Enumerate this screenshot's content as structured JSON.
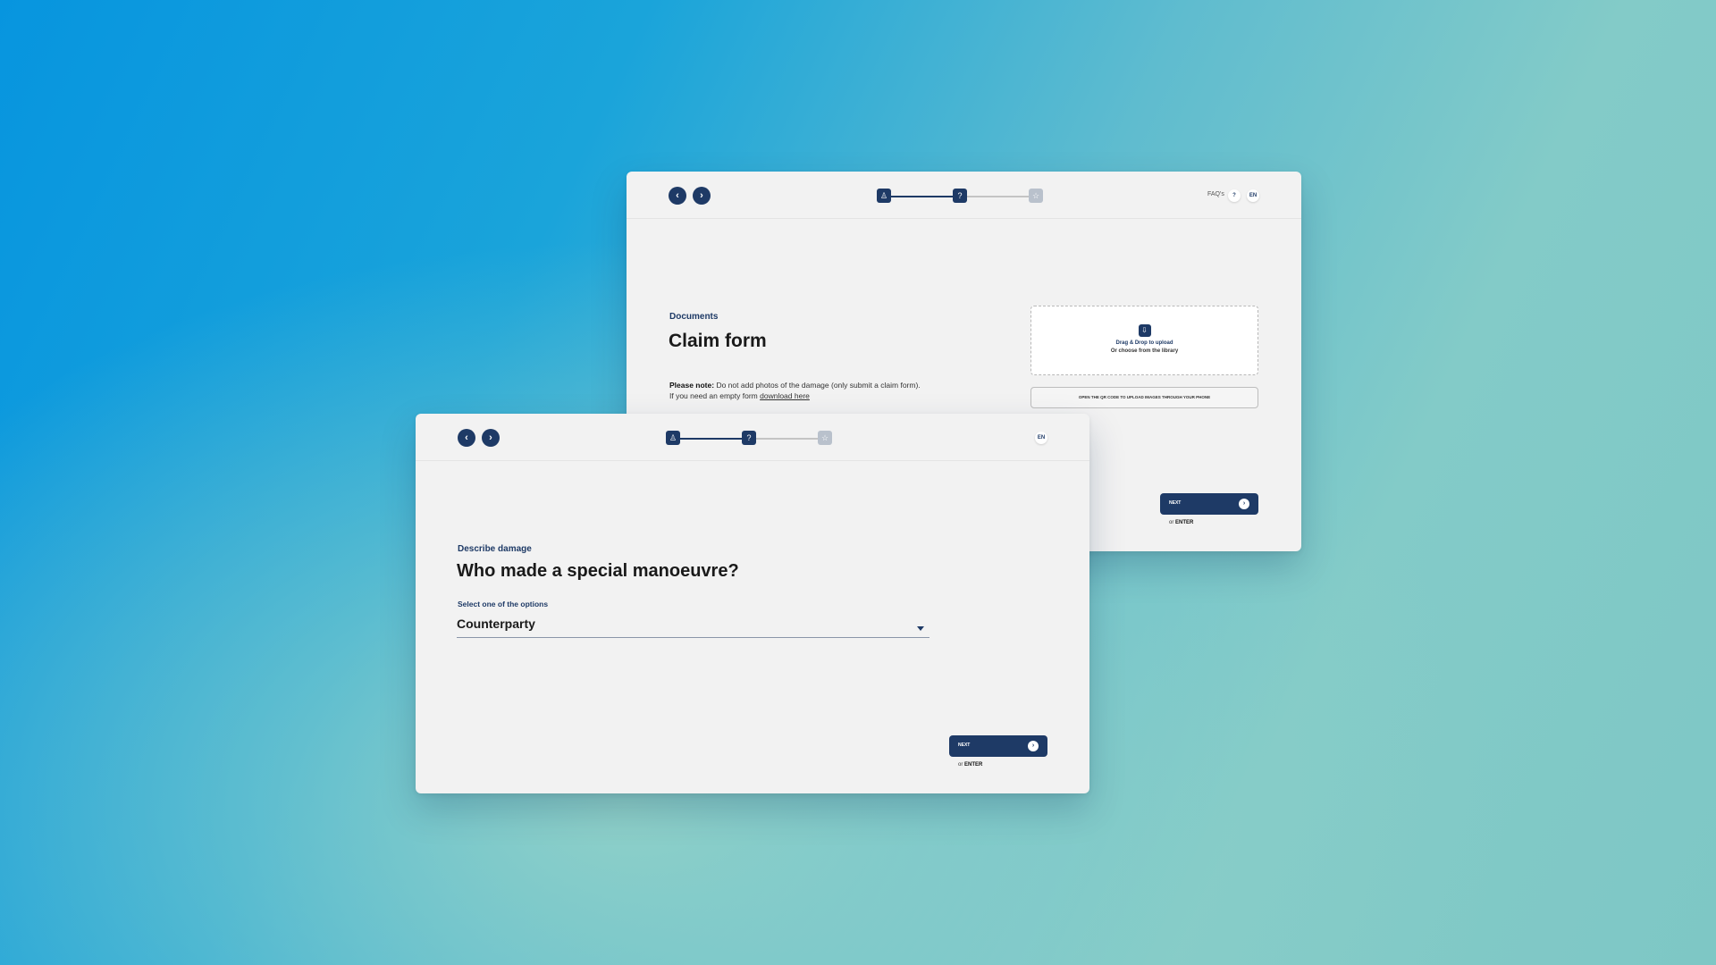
{
  "colors": {
    "primary": "#1e3a66",
    "inactive": "#b9c1cc",
    "card_bg": "#f2f2f2"
  },
  "back_card": {
    "nav": {
      "back_icon": "chevron-left-icon",
      "back_glyph": "‹",
      "forward_icon": "chevron-right-icon",
      "forward_glyph": "›"
    },
    "steps": [
      {
        "icon": "user-icon",
        "glyph": "♙",
        "state": "done"
      },
      {
        "icon": "question-icon",
        "glyph": "?",
        "state": "current"
      },
      {
        "icon": "star-icon",
        "glyph": "☆",
        "state": "upcoming"
      }
    ],
    "faq_label": "FAQ's",
    "faq_glyph": "?",
    "language": "EN",
    "eyebrow": "Documents",
    "title": "Claim form",
    "note_bold": "Please note:",
    "note_text": "Do not add photos of the damage (only submit a claim form).",
    "note_line2": "If you need an empty form",
    "download_link": "download here",
    "dropzone_line1": "Drag & Drop to upload",
    "dropzone_line2": "Or choose from the library",
    "dropzone_icon": "upload-icon",
    "dropzone_glyph": "⇩",
    "qr_button": "OPEN THE QR CODE TO UPLOAD IMAGES THROUGH YOUR PHONE",
    "next_label": "NEXT",
    "next_glyph": "›",
    "enter_prefix": "or",
    "enter_key": "ENTER"
  },
  "front_card": {
    "nav": {
      "back_glyph": "‹",
      "forward_glyph": "›"
    },
    "steps": [
      {
        "icon": "user-icon",
        "glyph": "♙",
        "state": "done"
      },
      {
        "icon": "question-icon",
        "glyph": "?",
        "state": "current"
      },
      {
        "icon": "star-icon",
        "glyph": "☆",
        "state": "upcoming"
      }
    ],
    "language": "EN",
    "eyebrow": "Describe damage",
    "title": "Who made a special manoeuvre?",
    "select_label": "Select one of the options",
    "select_value": "Counterparty",
    "next_label": "NEXT",
    "next_glyph": "›",
    "enter_prefix": "or",
    "enter_key": "ENTER"
  }
}
